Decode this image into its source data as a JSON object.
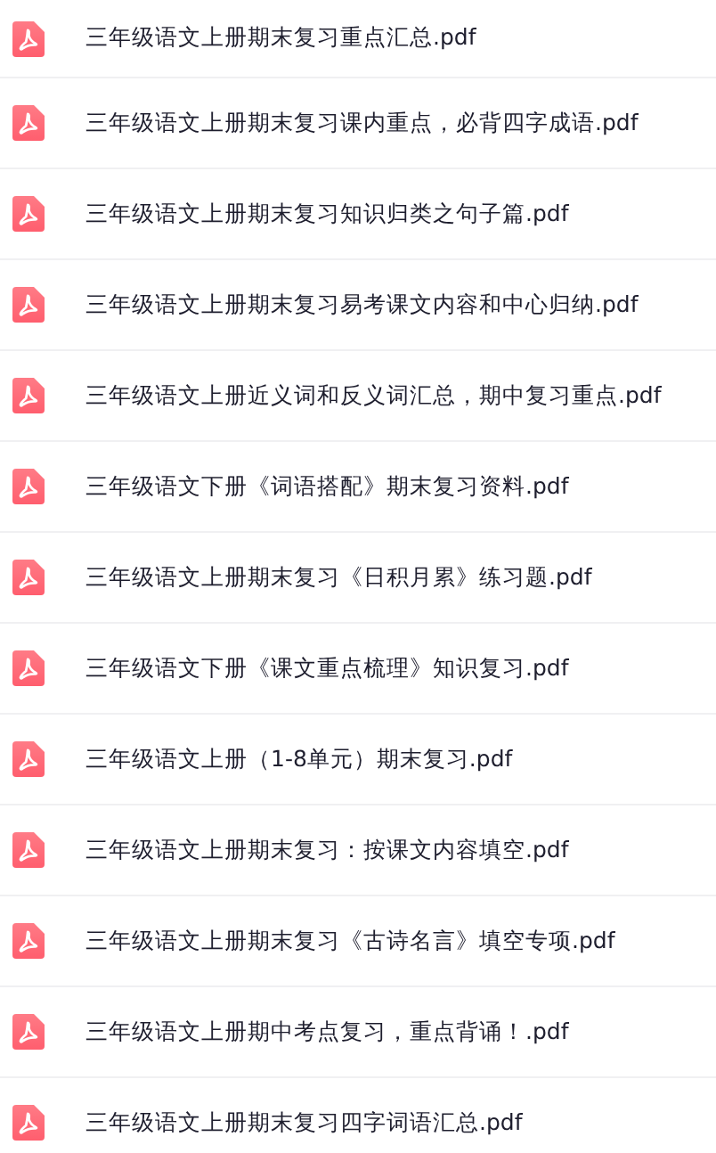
{
  "files": [
    {
      "name": "三年级语文上册期末复习重点汇总.pdf"
    },
    {
      "name": "三年级语文上册期末复习课内重点，必背四字成语.pdf"
    },
    {
      "name": "三年级语文上册期末复习知识归类之句子篇.pdf"
    },
    {
      "name": "三年级语文上册期末复习易考课文内容和中心归纳.pdf"
    },
    {
      "name": "三年级语文上册近义词和反义词汇总，期中复习重点.pdf"
    },
    {
      "name": "三年级语文下册《词语搭配》期末复习资料.pdf"
    },
    {
      "name": "三年级语文上册期末复习《日积月累》练习题.pdf"
    },
    {
      "name": "三年级语文下册《课文重点梳理》知识复习.pdf"
    },
    {
      "name": "三年级语文上册（1-8单元）期末复习.pdf"
    },
    {
      "name": "三年级语文上册期末复习：按课文内容填空.pdf"
    },
    {
      "name": "三年级语文上册期末复习《古诗名言》填空专项.pdf"
    },
    {
      "name": "三年级语文上册期中考点复习，重点背诵！.pdf"
    },
    {
      "name": "三年级语文上册期末复习四字词语汇总.pdf"
    }
  ]
}
